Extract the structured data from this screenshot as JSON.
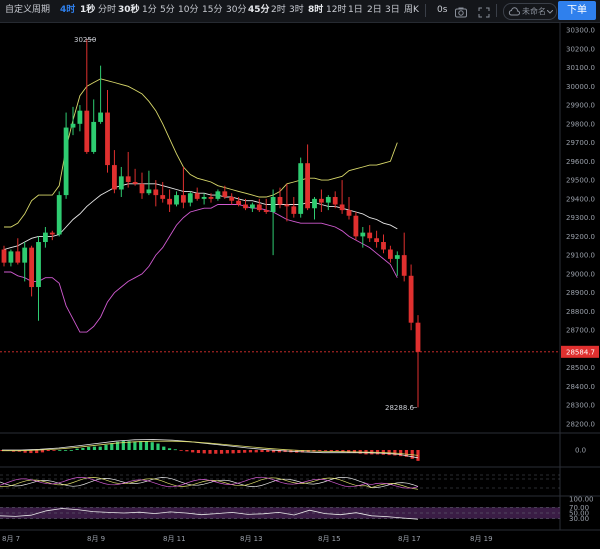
{
  "toolbar": {
    "custom_period": "自定义周期",
    "intervals": [
      {
        "label": "4时",
        "style": "active"
      },
      {
        "label": "1秒",
        "style": "bold"
      },
      {
        "label": "分时",
        "style": "normal"
      },
      {
        "label": "30秒",
        "style": "bold"
      },
      {
        "label": "1分",
        "style": "normal"
      },
      {
        "label": "5分",
        "style": "normal"
      },
      {
        "label": "10分",
        "style": "normal"
      },
      {
        "label": "15分",
        "style": "normal"
      },
      {
        "label": "30分",
        "style": "normal"
      },
      {
        "label": "45分",
        "style": "bold"
      },
      {
        "label": "2时",
        "style": "normal"
      },
      {
        "label": "3时",
        "style": "normal"
      },
      {
        "label": "8时",
        "style": "bold"
      },
      {
        "label": "12时",
        "style": "normal"
      },
      {
        "label": "1日",
        "style": "normal"
      },
      {
        "label": "2日",
        "style": "normal"
      },
      {
        "label": "3日",
        "style": "normal"
      },
      {
        "label": "周K",
        "style": "normal"
      }
    ],
    "timer": "0s",
    "save_name": "未命名",
    "order_button": "下单"
  },
  "chart_data": {
    "type": "candlestick",
    "main_axis": {
      "ticks": [
        "30300.0",
        "30200.0",
        "30100.0",
        "30000.0",
        "29900.0",
        "29800.0",
        "29700.0",
        "29600.0",
        "29500.0",
        "29400.0",
        "29300.0",
        "29200.0",
        "29100.0",
        "29000.0",
        "28900.0",
        "28800.0",
        "28700.0",
        "28600.0",
        "28500.0",
        "28400.0",
        "28300.0",
        "28200.0"
      ],
      "ylim": [
        28200,
        30300
      ]
    },
    "last_price": "28584.7",
    "high_marker": "30250",
    "low_marker": "28288.6",
    "macd_axis_label": "0.0",
    "rsi_axis": [
      "100.00",
      "70.00",
      "50.00",
      "30.00"
    ],
    "x_labels": [
      "8月 7",
      "8月 9",
      "8月 11",
      "8月 13",
      "8月 15",
      "8月 17",
      "8月 19"
    ],
    "colors": {
      "up": "#2ecc71",
      "down": "#e0302f",
      "bb_mid": "#e8e8e8",
      "bb_upper": "#d8d86a",
      "bb_lower": "#d05ad0",
      "dif": "#e8e8e8",
      "dea": "#d8d86a",
      "kdj_j": "#d05ad0",
      "rsi": "#e8e8e8"
    },
    "candles": [
      [
        29130,
        29150,
        29040,
        29060
      ],
      [
        29060,
        29130,
        29040,
        29120
      ],
      [
        29120,
        29190,
        29050,
        29060
      ],
      [
        29060,
        29170,
        28960,
        29140
      ],
      [
        29140,
        29150,
        28880,
        28930
      ],
      [
        28930,
        29200,
        28750,
        29170
      ],
      [
        29170,
        29250,
        29140,
        29220
      ],
      [
        29220,
        29230,
        29180,
        29210
      ],
      [
        29210,
        29440,
        29200,
        29420
      ],
      [
        29420,
        29860,
        29400,
        29780
      ],
      [
        29780,
        29890,
        29740,
        29800
      ],
      [
        29800,
        29900,
        29760,
        29870
      ],
      [
        29870,
        30250,
        29640,
        29650
      ],
      [
        29650,
        29930,
        29640,
        29810
      ],
      [
        29810,
        30110,
        29800,
        29860
      ],
      [
        29860,
        29980,
        29540,
        29580
      ],
      [
        29580,
        29660,
        29430,
        29450
      ],
      [
        29450,
        29570,
        29410,
        29520
      ],
      [
        29520,
        29650,
        29460,
        29490
      ],
      [
        29490,
        29560,
        29470,
        29480
      ],
      [
        29480,
        29540,
        29400,
        29430
      ],
      [
        29430,
        29550,
        29420,
        29450
      ],
      [
        29450,
        29500,
        29360,
        29420
      ],
      [
        29420,
        29490,
        29380,
        29400
      ],
      [
        29400,
        29450,
        29330,
        29370
      ],
      [
        29370,
        29440,
        29360,
        29420
      ],
      [
        29420,
        29570,
        29350,
        29380
      ],
      [
        29380,
        29440,
        29360,
        29430
      ],
      [
        29430,
        29460,
        29390,
        29400
      ],
      [
        29400,
        29430,
        29370,
        29410
      ],
      [
        29410,
        29430,
        29380,
        29400
      ],
      [
        29400,
        29450,
        29390,
        29440
      ],
      [
        29440,
        29470,
        29400,
        29410
      ],
      [
        29410,
        29430,
        29370,
        29390
      ],
      [
        29390,
        29410,
        29360,
        29370
      ],
      [
        29370,
        29400,
        29340,
        29350
      ],
      [
        29350,
        29380,
        29330,
        29370
      ],
      [
        29370,
        29400,
        29330,
        29340
      ],
      [
        29340,
        29400,
        29320,
        29330
      ],
      [
        29330,
        29450,
        29100,
        29410
      ],
      [
        29410,
        29460,
        29350,
        29370
      ],
      [
        29370,
        29480,
        29280,
        29360
      ],
      [
        29360,
        29410,
        29300,
        29320
      ],
      [
        29320,
        29620,
        29300,
        29590
      ],
      [
        29590,
        29690,
        29340,
        29350
      ],
      [
        29350,
        29410,
        29290,
        29400
      ],
      [
        29400,
        29450,
        29330,
        29380
      ],
      [
        29380,
        29420,
        29340,
        29410
      ],
      [
        29410,
        29440,
        29350,
        29370
      ],
      [
        29370,
        29500,
        29320,
        29340
      ],
      [
        29340,
        29410,
        29290,
        29310
      ],
      [
        29310,
        29330,
        29180,
        29200
      ],
      [
        29200,
        29250,
        29140,
        29220
      ],
      [
        29220,
        29260,
        29170,
        29190
      ],
      [
        29190,
        29230,
        29140,
        29170
      ],
      [
        29170,
        29210,
        29110,
        29130
      ],
      [
        29130,
        29150,
        29060,
        29080
      ],
      [
        29080,
        29120,
        28990,
        29100
      ],
      [
        29100,
        29220,
        28960,
        28990
      ],
      [
        28990,
        29050,
        28700,
        28740
      ],
      [
        28740,
        28780,
        28288.6,
        28584.7
      ]
    ],
    "bb_mid": [
      29130,
      29140,
      29150,
      29170,
      29190,
      29200,
      29200,
      29200,
      29210,
      29250,
      29290,
      29320,
      29360,
      29390,
      29420,
      29440,
      29460,
      29470,
      29480,
      29480,
      29480,
      29480,
      29480,
      29470,
      29460,
      29450,
      29440,
      29440,
      29430,
      29430,
      29420,
      29420,
      29410,
      29410,
      29400,
      29390,
      29390,
      29380,
      29370,
      29370,
      29370,
      29370,
      29370,
      29370,
      29380,
      29380,
      29370,
      29360,
      29360,
      29350,
      29340,
      29330,
      29320,
      29300,
      29290,
      29270,
      29260,
      29240
    ],
    "bb_upper": [
      29250,
      29250,
      29270,
      29320,
      29390,
      29420,
      29420,
      29420,
      29470,
      29670,
      29820,
      29950,
      30000,
      30020,
      30040,
      30030,
      30020,
      30010,
      30000,
      29980,
      29960,
      29920,
      29870,
      29800,
      29720,
      29640,
      29570,
      29530,
      29510,
      29500,
      29490,
      29470,
      29460,
      29450,
      29440,
      29430,
      29420,
      29410,
      29410,
      29420,
      29440,
      29480,
      29490,
      29500,
      29510,
      29510,
      29500,
      29500,
      29510,
      29520,
      29550,
      29560,
      29570,
      29580,
      29580,
      29590,
      29600,
      29700
    ],
    "bb_lower": [
      29010,
      29010,
      28990,
      28980,
      28960,
      28960,
      28980,
      28980,
      28950,
      28830,
      28760,
      28690,
      28690,
      28720,
      28770,
      28850,
      28900,
      28930,
      28960,
      28980,
      29000,
      29040,
      29100,
      29140,
      29200,
      29260,
      29300,
      29330,
      29340,
      29350,
      29350,
      29370,
      29370,
      29370,
      29370,
      29360,
      29350,
      29350,
      29340,
      29330,
      29310,
      29290,
      29280,
      29270,
      29270,
      29270,
      29270,
      29260,
      29250,
      29230,
      29200,
      29180,
      29160,
      29140,
      29110,
      29080,
      29050,
      28980
    ],
    "macd_hist": [
      -0.3,
      -0.3,
      -0.5,
      -0.5,
      -0.8,
      -0.9,
      -0.9,
      -0.7,
      -0.3,
      -0.2,
      0.0,
      0.0,
      0.0,
      0.4,
      0.6,
      0.9,
      1.0,
      1.0,
      1.5,
      2.0,
      2.4,
      2.7,
      2.6,
      2.4,
      2.6,
      2.6,
      2.3,
      1.9,
      1.0,
      0.5,
      0.2,
      -0.1,
      -0.4,
      -0.7,
      -0.9,
      -1.0,
      -1.1,
      -1.1,
      -1.1,
      -1.0,
      -1.0,
      -0.9,
      -0.8,
      -0.7,
      -0.7,
      -0.6,
      -0.6,
      -0.7,
      -0.7,
      -0.6,
      -0.7,
      -0.8,
      -0.7,
      -0.6,
      -0.5,
      -0.3,
      -0.2,
      -0.4,
      -0.3,
      -0.6,
      -0.7,
      -0.9,
      -1.1,
      -1.3,
      -1.3,
      -1.3,
      -1.4,
      -1.5,
      -1.6,
      -1.8,
      -2.0,
      -2.6,
      -3.2
    ],
    "dif": [
      0.0,
      0.0,
      0.2,
      0.6,
      1.2,
      1.9,
      2.6,
      3.0,
      3.1,
      2.9,
      2.4,
      1.8,
      1.2,
      0.6,
      0.1,
      -0.3,
      -0.6,
      -0.8,
      -0.8,
      -0.8,
      -0.9,
      -1.3,
      -2.3
    ],
    "dea": [
      -0.2,
      -0.2,
      0.0,
      0.3,
      0.8,
      1.4,
      2.0,
      2.4,
      2.6,
      2.6,
      2.4,
      2.0,
      1.5,
      1.0,
      0.5,
      0.1,
      -0.2,
      -0.4,
      -0.5,
      -0.6,
      -0.7,
      -1.0,
      -1.6
    ],
    "rsi_line": [
      40,
      38,
      42,
      58,
      66,
      62,
      55,
      52,
      50,
      53,
      48,
      54,
      50,
      44,
      48,
      52,
      45,
      47,
      52,
      43,
      60,
      48,
      44,
      51,
      40,
      37,
      32,
      28
    ]
  }
}
